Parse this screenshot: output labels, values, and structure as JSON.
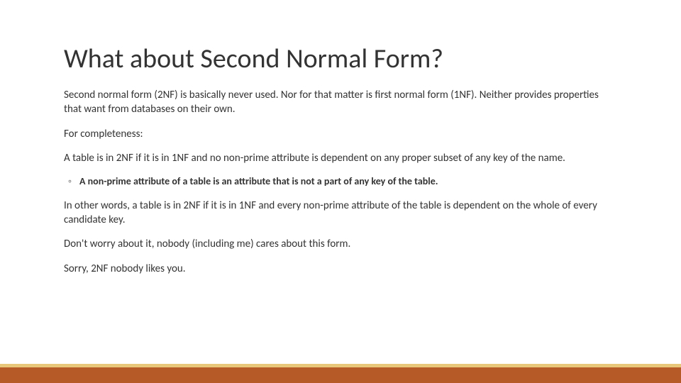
{
  "slide": {
    "title": "What about Second Normal Form?",
    "para1": "Second normal form (2NF) is basically never used. Nor for that matter is first normal form (1NF). Neither provides properties that want from databases on their own.",
    "para2": "For completeness:",
    "para3": "A table is in 2NF if it is in 1NF and no non-prime attribute is dependent on any proper subset of any key of the name.",
    "bullet1": "A non-prime attribute of a table is an attribute that is not a part of any key of the table.",
    "para4": "In other words, a table is in 2NF if it is in 1NF and every non-prime attribute of the table is dependent on the whole of every candidate key.",
    "para5": "Don't worry about it, nobody (including me) cares about this form.",
    "para6": "Sorry, 2NF nobody likes you."
  },
  "colors": {
    "footer_bar": "#b65a27",
    "footer_accent": "#e8c77a"
  }
}
